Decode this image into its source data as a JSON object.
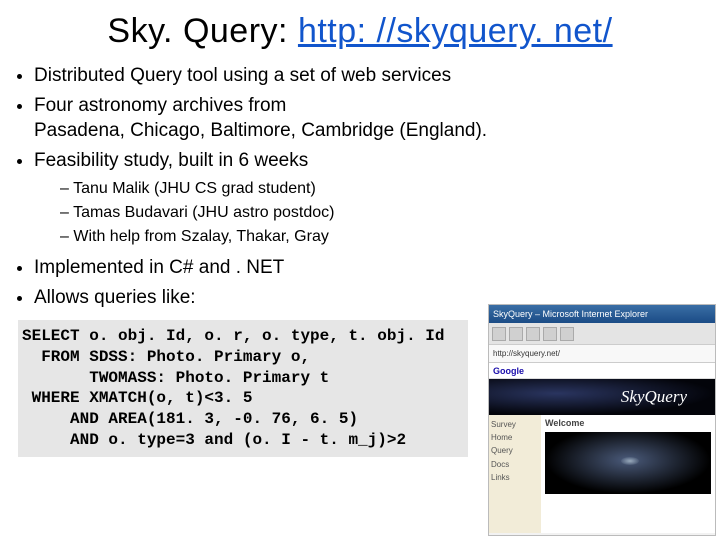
{
  "title_prefix": "Sky. Query: ",
  "title_link": "http: //skyquery. net/",
  "bullets_top": [
    "Distributed Query tool using a set of web services",
    "Four astronomy archives from\nPasadena, Chicago, Baltimore, Cambridge (England).",
    "Feasibility study, built in 6 weeks"
  ],
  "sub_bullets": [
    "Tanu Malik (JHU CS grad student)",
    "Tamas Budavari (JHU astro postdoc)",
    "With help from Szalay, Thakar, Gray"
  ],
  "bullets_impl": [
    "Implemented in C# and . NET",
    "Allows queries like:"
  ],
  "query": "SELECT o. obj. Id, o. r, o. type, t. obj. Id\n  FROM SDSS: Photo. Primary o,\n       TWOMASS: Photo. Primary t\n WHERE XMATCH(o, t)<3. 5\n     AND AREA(181. 3, -0. 76, 6. 5)\n     AND o. type=3 and (o. I - t. m_j)>2",
  "screenshot": {
    "titlebar": "SkyQuery – Microsoft Internet Explorer",
    "toolbar_label": "toolbar",
    "url": "http://skyquery.net/",
    "google_label": "Google",
    "brand": "SkyQuery",
    "nav": [
      "Survey",
      "Home",
      "Query",
      "Docs",
      "Links"
    ],
    "panel_title": "Welcome"
  }
}
